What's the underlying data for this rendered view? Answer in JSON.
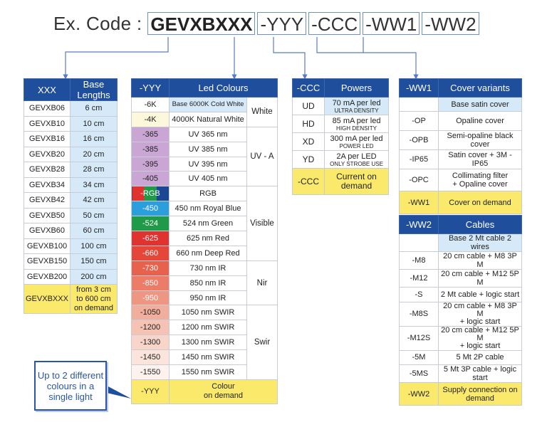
{
  "header": {
    "label": "Ex. Code :",
    "segments": [
      "GEVXBXXX",
      "-YYY",
      "-CCC",
      "-WW1",
      "-WW2"
    ]
  },
  "lengths": {
    "headers": [
      "XXX",
      "Base Lengths"
    ],
    "rows": [
      [
        "GEVXB06",
        "6 cm"
      ],
      [
        "GEVXB10",
        "10 cm"
      ],
      [
        "GEVXB16",
        "16 cm"
      ],
      [
        "GEVXB20",
        "20 cm"
      ],
      [
        "GEVXB28",
        "28 cm"
      ],
      [
        "GEVXB34",
        "34 cm"
      ],
      [
        "GEVXB42",
        "42 cm"
      ],
      [
        "GEVXB50",
        "50 cm"
      ],
      [
        "GEVXB60",
        "60 cm"
      ],
      [
        "GEVXB100",
        "100 cm"
      ],
      [
        "GEVXB150",
        "150 cm"
      ],
      [
        "GEVXB200",
        "200 cm"
      ]
    ],
    "on_demand": {
      "code": "GEVXBXXX",
      "line1": "from 3 cm",
      "line2": "to 600 cm",
      "line3": "on demand"
    }
  },
  "colours": {
    "headers": [
      "-YYY",
      "Led Colours"
    ],
    "groups": [
      "White",
      "UV - A",
      "Visible",
      "Nir",
      "Swir"
    ],
    "rows": [
      {
        "code": "-6K",
        "name": "Base 6000K Cold White",
        "swatch": "#ffffff"
      },
      {
        "code": "-4K",
        "name": "4000K Natural White",
        "swatch": "#fdf7dc"
      },
      {
        "code": "-365",
        "name": "UV 365 nm",
        "swatch": "#c9a6d3"
      },
      {
        "code": "-385",
        "name": "UV 385 nm",
        "swatch": "#c9a6d3"
      },
      {
        "code": "-395",
        "name": "UV 395 nm",
        "swatch": "#c9a6d3"
      },
      {
        "code": "-405",
        "name": "UV 405 nm",
        "swatch": "#c9a6d3"
      },
      {
        "code": "-RGB",
        "name": "RGB",
        "swatch": "rgb"
      },
      {
        "code": "-450",
        "name": "450 nm Royal Blue",
        "swatch": "#2a9fdc"
      },
      {
        "code": "-524",
        "name": "524 nm Green",
        "swatch": "#1f9a48"
      },
      {
        "code": "-625",
        "name": "625 nm Red",
        "swatch": "#e0332f"
      },
      {
        "code": "-660",
        "name": "660 nm Deep Red",
        "swatch": "#e4463a"
      },
      {
        "code": "-730",
        "name": "730 nm IR",
        "swatch": "#e8614d"
      },
      {
        "code": "-850",
        "name": "850 nm IR",
        "swatch": "#ec7c67"
      },
      {
        "code": "-950",
        "name": "950 nm IR",
        "swatch": "#ef9682"
      },
      {
        "code": "-1050",
        "name": "1050 nm SWIR",
        "swatch": "#f2ae9c"
      },
      {
        "code": "-1200",
        "name": "1200 nm SWIR",
        "swatch": "#f5c2b4"
      },
      {
        "code": "-1300",
        "name": "1300 nm SWIR",
        "swatch": "#f8d4c9"
      },
      {
        "code": "-1450",
        "name": "1450 nm SWIR",
        "swatch": "#fbe4dc"
      },
      {
        "code": "-1550",
        "name": "1550 nm SWIR",
        "swatch": "#fdf2ee"
      }
    ],
    "on_demand": {
      "code": "-YYY",
      "line1": "Colour",
      "line2": "on demand"
    }
  },
  "powers": {
    "headers": [
      "-CCC",
      "Powers"
    ],
    "rows": [
      {
        "code": "UD",
        "main": "70 mA per led",
        "sub": "Ultra density"
      },
      {
        "code": "HD",
        "main": "85 mA per led",
        "sub": "High density"
      },
      {
        "code": "XD",
        "main": "300 mA per led",
        "sub": "Power LED"
      },
      {
        "code": "YD",
        "main": "2A per LED",
        "sub": "Only strobe use"
      }
    ],
    "on_demand": {
      "code": "-CCC",
      "line1": "Current on",
      "line2": "demand"
    }
  },
  "covers": {
    "headers": [
      "-WW1",
      "Cover variants"
    ],
    "base": "Base satin cover",
    "rows": [
      {
        "code": "-OP",
        "line1": "Opaline cover",
        "line2": ""
      },
      {
        "code": "-OPB",
        "line1": "Semi-opaline black cover",
        "line2": ""
      },
      {
        "code": "-IP65",
        "line1": "Satin cover + 3M - IP65",
        "line2": ""
      },
      {
        "code": "-OPC",
        "line1": "Collimating filter",
        "line2": "+ Opaline cover"
      }
    ],
    "on_demand": {
      "code": "-WW1",
      "line1": "Cover on demand"
    }
  },
  "cables": {
    "headers": [
      "-WW2",
      "Cables"
    ],
    "base": "Base 2 Mt cable 2 wires",
    "rows": [
      {
        "code": "-M8",
        "line1": "20 cm cable + M8 3P M",
        "line2": ""
      },
      {
        "code": "-M12",
        "line1": "20 cm cable + M12 5P M",
        "line2": ""
      },
      {
        "code": "-S",
        "line1": "2 Mt cable + logic start",
        "line2": ""
      },
      {
        "code": "-M8S",
        "line1": "20 cm cable + M8 3P M",
        "line2": "+ logic start"
      },
      {
        "code": "-M12S",
        "line1": "20 cm cable + M12 5P M",
        "line2": "+ logic start"
      },
      {
        "code": "-5M",
        "line1": "5 Mt 2P cable",
        "line2": ""
      },
      {
        "code": "-5MS",
        "line1": "5 Mt 3P cable + logic start",
        "line2": ""
      }
    ],
    "on_demand": {
      "code": "-WW2",
      "line1": "Supply connection on",
      "line2": "demand"
    }
  },
  "callout": {
    "text": "Up to 2 different colours in a single light"
  },
  "colors": {
    "header_blue": "#1f4e9c",
    "highlight_yellow": "#fbe96c",
    "base_blue": "#d5e9f8",
    "connector": "#5a7dc0"
  }
}
